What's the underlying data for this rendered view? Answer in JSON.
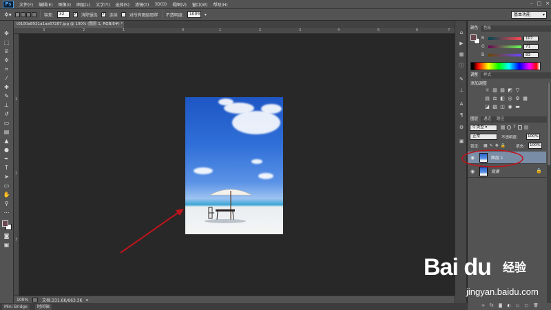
{
  "menubar": {
    "app_logo": "Ps",
    "items": [
      "文件(F)",
      "编辑(E)",
      "图像(I)",
      "图层(L)",
      "文字(Y)",
      "选择(S)",
      "滤镜(T)",
      "3D(D)",
      "视图(V)",
      "窗口(W)",
      "帮助(H)"
    ],
    "window_controls": [
      "–",
      "□",
      "×"
    ]
  },
  "options": {
    "tolerance_label": "容差:",
    "tolerance_value": "32",
    "antialias_label": "消除锯齿",
    "contiguous_label": "连续",
    "sample_all_label": "对所有图层取样",
    "opacity_label": "不透明度:",
    "opacity_value": "100%",
    "workspace": "基本功能"
  },
  "document": {
    "tab_title": "t0100a8931a1aa67287.jpg @ 100% (图层 1, RGB/8#) *",
    "ruler_h": [
      "3",
      "2",
      "1",
      "0",
      "1",
      "2",
      "3",
      "4",
      "5",
      "6",
      "7"
    ],
    "ruler_v": [
      "1",
      "2",
      "3"
    ]
  },
  "status": {
    "zoom": "100%",
    "doc_info": "文档:331.6K/663.3K"
  },
  "bottom_tabs": [
    "Mini Bridge",
    "时间轴"
  ],
  "color_panel": {
    "tabs": [
      "颜色",
      "色板"
    ],
    "r_label": "R",
    "r_value": "107",
    "g_label": "G",
    "g_value": "71",
    "b_label": "B",
    "b_value": "83",
    "foreground_hex": "#6b4750"
  },
  "adjust_panel": {
    "tabs": [
      "调整",
      "样式"
    ],
    "title": "添加调整"
  },
  "layers_panel": {
    "tabs": [
      "图层",
      "通道",
      "路径"
    ],
    "kind_label": "类型",
    "blend_mode": "正常",
    "opacity_label": "不透明度:",
    "opacity_value": "100%",
    "lock_label": "锁定:",
    "fill_label": "填充:",
    "fill_value": "100%",
    "layers": [
      {
        "name": "图层 1",
        "selected": true
      },
      {
        "name": "背景",
        "locked": true
      }
    ],
    "footer_icons": [
      "link-icon",
      "fx-icon",
      "mask-icon",
      "adjustment-icon",
      "folder-icon",
      "new-layer-icon",
      "trash-icon"
    ]
  },
  "annotation": {
    "arrow_color": "#c0141c",
    "circle_color": "#c0141c"
  },
  "watermark": {
    "logo": "Bai du",
    "cn": "经验",
    "url": "jingyan.baidu.com"
  }
}
